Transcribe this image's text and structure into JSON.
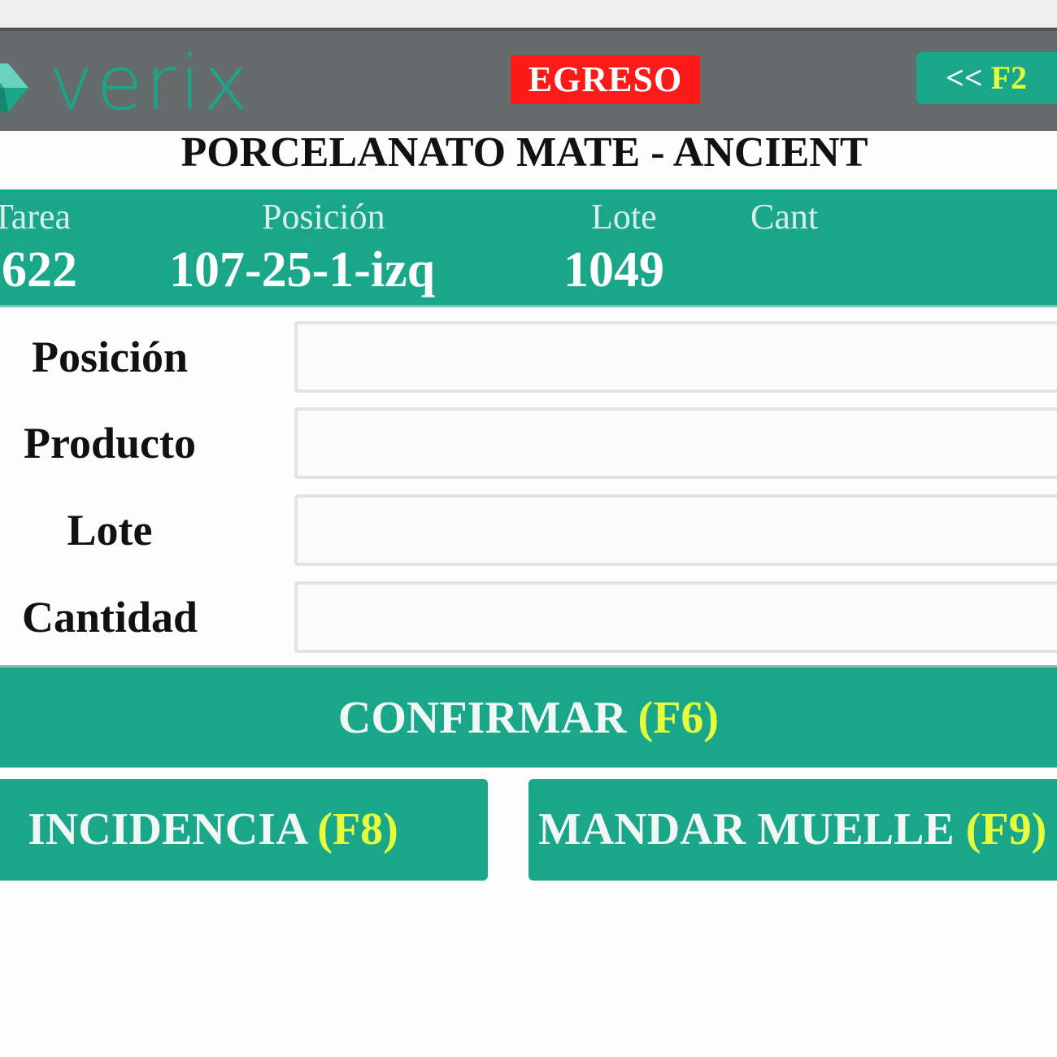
{
  "app": {
    "logo_text": "verix",
    "mode_badge": "EGRESO",
    "back_button": {
      "prefix": "<< ",
      "key": "F2"
    },
    "colors": {
      "accent": "#1aa789",
      "header": "#646c6c",
      "badge": "#ff1a1a",
      "key_highlight": "#e6ff3c"
    }
  },
  "product": {
    "title": "PORCELANATO MATE - ANCIENT"
  },
  "task": {
    "headers": {
      "tarea": "Tarea",
      "posicion": "Posición",
      "lote": "Lote",
      "cant": "Cant"
    },
    "values": {
      "tarea": "622",
      "posicion": "107-25-1-izq",
      "lote": "1049",
      "cant": ""
    }
  },
  "form": {
    "fields": [
      {
        "label": "Posición",
        "value": ""
      },
      {
        "label": "Producto",
        "value": ""
      },
      {
        "label": "Lote",
        "value": ""
      },
      {
        "label": "Cantidad",
        "value": ""
      }
    ]
  },
  "actions": {
    "confirm": {
      "label": "CONFIRMAR ",
      "key": "(F6)"
    },
    "incidencia": {
      "label": "INCIDENCIA ",
      "key": "(F8)"
    },
    "muelle": {
      "label": "MANDAR MUELLE ",
      "key": "(F9)"
    }
  }
}
